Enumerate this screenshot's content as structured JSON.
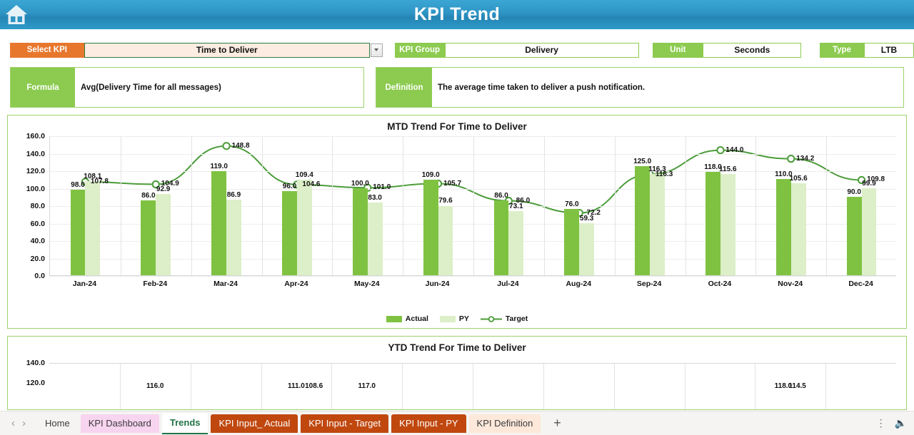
{
  "header": {
    "title": "KPI Trend",
    "home_icon": "home-icon"
  },
  "controls": {
    "select_kpi_label": "Select KPI",
    "select_kpi_value": "Time to Deliver",
    "dropdown_icon": "chevron-down-icon",
    "kpi_group_label": "KPI Group",
    "kpi_group_value": "Delivery",
    "unit_label": "Unit",
    "unit_value": "Seconds",
    "type_label": "Type",
    "type_value": "LTB"
  },
  "meta": {
    "formula_label": "Formula",
    "formula_value": "Avg(Delivery Time for all messages)",
    "definition_label": "Definition",
    "definition_value": "The average time taken to deliver a push notification."
  },
  "chart_data": [
    {
      "id": "mtd",
      "type": "bar",
      "title": "MTD Trend For Time to Deliver",
      "xlabel": "",
      "ylabel": "",
      "ylim": [
        0,
        160
      ],
      "yticks": [
        "0.0",
        "20.0",
        "40.0",
        "60.0",
        "80.0",
        "100.0",
        "120.0",
        "140.0",
        "160.0"
      ],
      "ytick_values": [
        0,
        20,
        40,
        60,
        80,
        100,
        120,
        140,
        160
      ],
      "grid": true,
      "legend_position": "bottom",
      "categories": [
        "Jan-24",
        "Feb-24",
        "Mar-24",
        "Apr-24",
        "May-24",
        "Jun-24",
        "Jul-24",
        "Aug-24",
        "Sep-24",
        "Oct-24",
        "Nov-24",
        "Dec-24"
      ],
      "series": [
        {
          "name": "Actual",
          "kind": "bar",
          "color": "#7fc242",
          "values": [
            98.0,
            86.0,
            119.0,
            96.0,
            100.0,
            109.0,
            86.0,
            76.0,
            125.0,
            118.0,
            110.0,
            90.0
          ],
          "labels": [
            "98.0",
            "86.0",
            "119.0",
            "96.0",
            "100.0",
            "109.0",
            "86.0",
            "76.0",
            "125.0",
            "118.0",
            "110.0",
            "90.0"
          ]
        },
        {
          "name": "PY",
          "kind": "bar",
          "color": "#dcefc8",
          "values": [
            108.1,
            92.9,
            86.9,
            109.4,
            83.0,
            79.6,
            73.1,
            59.3,
            116.3,
            115.6,
            105.6,
            99.9
          ],
          "labels": [
            "108.1",
            "92.9",
            "86.9",
            "109.4",
            "83.0",
            "79.6",
            "73.1",
            "59.3",
            "116.3",
            "115.6",
            "105.6",
            "99.9"
          ]
        },
        {
          "name": "Target",
          "kind": "line",
          "color": "#4c9c3a",
          "values": [
            107.8,
            104.9,
            148.8,
            104.6,
            101.0,
            105.7,
            86.0,
            72.2,
            116.3,
            144.0,
            134.2,
            109.8
          ],
          "labels": [
            "107.8",
            "104.9",
            "148.8",
            "104.6",
            "101.0",
            "105.7",
            "86.0",
            "72.2",
            "116.3",
            "144.0",
            "134.2",
            "109.8"
          ]
        }
      ]
    },
    {
      "id": "ytd",
      "type": "bar",
      "title": "YTD Trend For Time to Deliver",
      "ylim": [
        0,
        140
      ],
      "yticks": [
        "140.0",
        "120.0"
      ],
      "grid": true,
      "note": "clipped at bottom of viewport",
      "visible_labels": [
        "116.0",
        "111.0",
        "108.6",
        "117.0",
        "118.0",
        "114.5"
      ]
    }
  ],
  "tabbar": {
    "prev_icon": "chevron-left-icon",
    "next_icon": "chevron-right-icon",
    "tabs": [
      {
        "label": "Home",
        "style": "plain"
      },
      {
        "label": "KPI Dashboard",
        "style": "pink"
      },
      {
        "label": "Trends",
        "style": "active"
      },
      {
        "label": "KPI Input_ Actual",
        "style": "rust"
      },
      {
        "label": "KPI Input - Target",
        "style": "rust"
      },
      {
        "label": "KPI Input - PY",
        "style": "rust"
      },
      {
        "label": "KPI Definition",
        "style": "peach"
      }
    ],
    "add_label": "+",
    "more_icon": "more-vertical-icon",
    "speaker_icon": "speaker-icon"
  },
  "colors": {
    "header_blue": "#2e94c4",
    "accent_orange": "#e8772e",
    "accent_green": "#8ccb4f",
    "actual_green": "#7fc242",
    "py_green": "#dcefc8",
    "target_line": "#4c9c3a",
    "tab_rust": "#c0480f"
  }
}
